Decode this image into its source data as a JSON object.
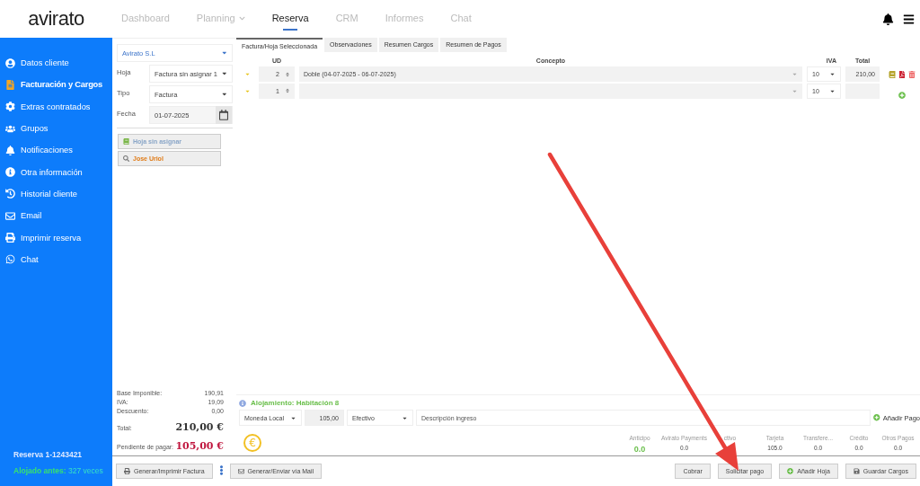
{
  "logo": "avirato",
  "nav": [
    {
      "label": "Dashboard",
      "selected": false,
      "has_menu": false
    },
    {
      "label": "Planning",
      "selected": false,
      "has_menu": true
    },
    {
      "label": "Reserva",
      "selected": true,
      "has_menu": false
    },
    {
      "label": "CRM",
      "selected": false,
      "has_menu": false
    },
    {
      "label": "Informes",
      "selected": false,
      "has_menu": false
    },
    {
      "label": "Chat",
      "selected": false,
      "has_menu": false
    }
  ],
  "sidebar": {
    "items": [
      {
        "label": "Datos cliente",
        "selected": false
      },
      {
        "label": "Facturación y Cargos",
        "selected": true
      },
      {
        "label": "Extras contratados",
        "selected": false
      },
      {
        "label": "Grupos",
        "selected": false
      },
      {
        "label": "Notificaciones",
        "selected": false
      },
      {
        "label": "Otra información",
        "selected": false
      },
      {
        "label": "Historial cliente",
        "selected": false
      },
      {
        "label": "Email",
        "selected": false
      },
      {
        "label": "Imprimir reserva",
        "selected": false
      },
      {
        "label": "Chat",
        "selected": false
      }
    ],
    "reservation": "Reserva 1-1243421",
    "stayed_label": "Alojado antes:",
    "stayed_count": "327 veces"
  },
  "invoice_form": {
    "company": "Avirato S.L",
    "fields": [
      {
        "label": "Hoja",
        "value": "Factura  sin asignar 1",
        "kind": "select"
      },
      {
        "label": "Tipo",
        "value": "Factura",
        "kind": "select"
      },
      {
        "label": "Fecha",
        "value": "01-07-2025",
        "kind": "date"
      }
    ],
    "buttons": [
      {
        "label": "Hoja sin asignar",
        "kind": "sheet"
      },
      {
        "label": "Jose Uriol",
        "kind": "search"
      }
    ]
  },
  "summary": [
    {
      "label": "Base Imponible:",
      "value": "190,91"
    },
    {
      "label": "IVA:",
      "value": "19,09"
    },
    {
      "label": "Descuento:",
      "value": "0,00"
    }
  ],
  "totals": [
    {
      "label": "Total:",
      "value": "210,00 €",
      "kind": "total"
    },
    {
      "label": "Pendiente de pagar:",
      "value": "105,00 €",
      "kind": "pending"
    }
  ],
  "tabs": [
    {
      "label": "Factura/Hoja Seleccionada",
      "selected": true
    },
    {
      "label": "Observaciones",
      "selected": false
    },
    {
      "label": "Resumen Cargos",
      "selected": false
    },
    {
      "label": "Resumen de Pagos",
      "selected": false
    }
  ],
  "lines": {
    "columns": [
      "UD",
      "Concepto",
      "IVA",
      "Total"
    ],
    "rows": [
      {
        "qty": "2",
        "concept": "Doble (04-07-2025 - 06-07-2025)",
        "iva": "10",
        "total": "210,00",
        "kind": "charge"
      },
      {
        "qty": "1",
        "iva": "10",
        "kind": "new"
      }
    ]
  },
  "payment": {
    "title": "Alojamiento: Habitación 8",
    "currency": "Moneda Local",
    "amount": "105,00",
    "method": "Efectivo",
    "description_placeholder": "Descripción ingreso",
    "add_label": "Añadir Pago",
    "currency_symbol": "€",
    "breakdown": [
      {
        "label": "Anticipo",
        "value": "0.0",
        "highlight": true
      },
      {
        "label": "Avirato Payments",
        "value": "0.0",
        "highlight": false
      },
      {
        "label": "ctivo"
      },
      {
        "label": "Tarjeta",
        "value": "105.0",
        "highlight": false
      },
      {
        "label": "Transfere...",
        "value": "0.0",
        "highlight": false
      },
      {
        "label": "Crédito",
        "value": "0.0",
        "highlight": false
      },
      {
        "label": "Otros Pagos",
        "value": "0.0",
        "highlight": false
      }
    ]
  },
  "footer": {
    "left": [
      {
        "label": "Generar/Imprimir Factura",
        "kind": "print"
      },
      {
        "label": "Generar/Enviar vía Mail",
        "kind": "mail"
      }
    ],
    "right": [
      {
        "label": "Cobrar",
        "kind": "plain"
      },
      {
        "label": "Solicitar pago",
        "kind": "plain"
      },
      {
        "label": "Añadir Hoja",
        "kind": "add"
      },
      {
        "label": "Guardar Cargos",
        "kind": "save"
      }
    ]
  }
}
